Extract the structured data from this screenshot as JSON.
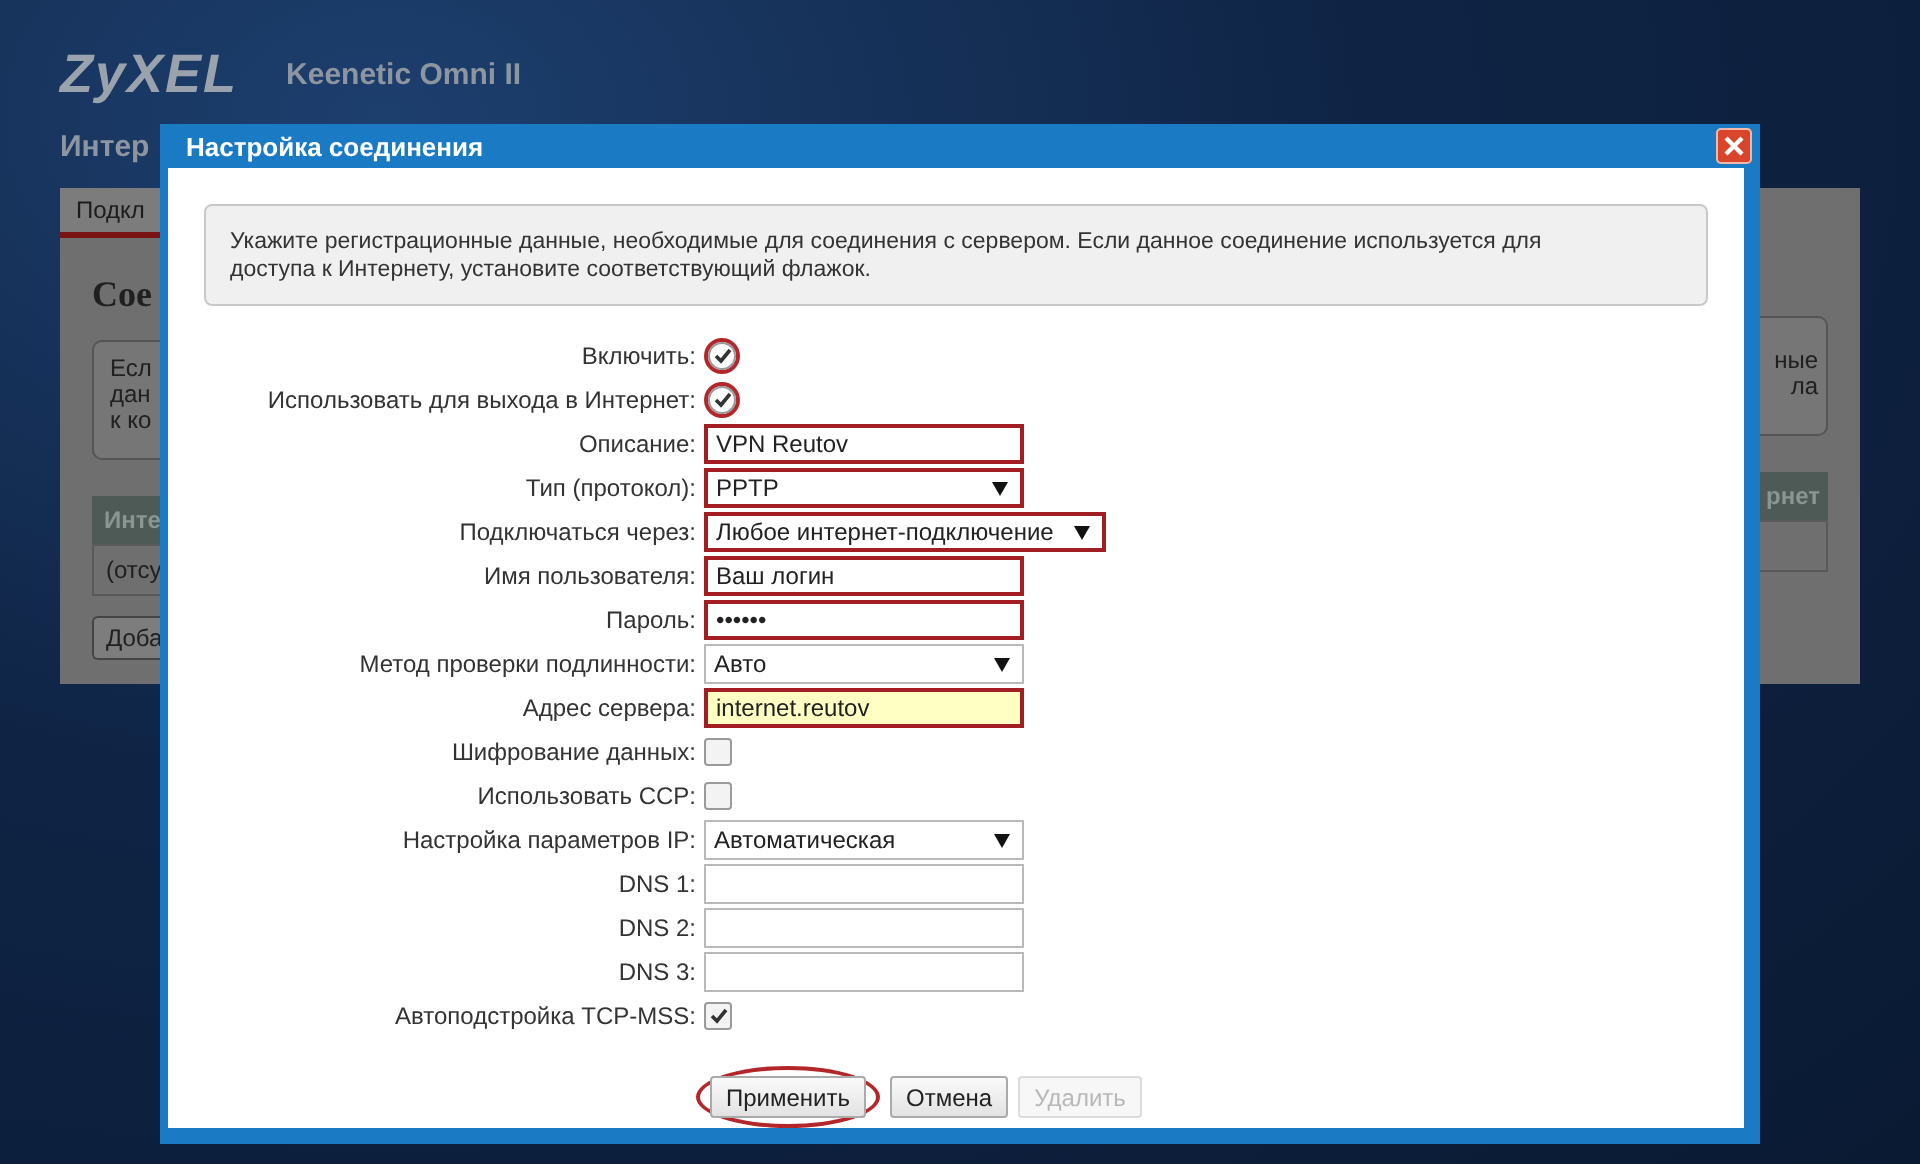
{
  "page": {
    "logo": "ZyXEL",
    "model": "Keenetic Omni II",
    "heading": "Интер",
    "tab": "Подкл",
    "section_title": "Сое",
    "info_left": [
      "Есл",
      "дан",
      "к ко"
    ],
    "info_right": [
      "ные",
      "ла"
    ],
    "table_header_left": "Инте",
    "table_header_right": "рнет",
    "table_row": "(отсу",
    "add_button": "Доба"
  },
  "dialog": {
    "title": "Настройка соединения",
    "intro": "Укажите регистрационные данные, необходимые для соединения с сервером. Если данное соединение используется для доступа к Интернету, установите соответствующий флажок.",
    "fields": [
      {
        "kind": "checkbox",
        "label": "Включить:",
        "checked": true,
        "highlighted": true
      },
      {
        "kind": "checkbox",
        "label": "Использовать для выхода в Интернет:",
        "checked": true,
        "highlighted": true
      },
      {
        "kind": "text",
        "label": "Описание:",
        "value": "VPN Reutov",
        "highlighted": true
      },
      {
        "kind": "select",
        "label": "Тип (протокол):",
        "value": "PPTP",
        "highlighted": true
      },
      {
        "kind": "select",
        "label": "Подключаться через:",
        "value": "Любое интернет-подключение",
        "highlighted": true
      },
      {
        "kind": "text",
        "label": "Имя пользователя:",
        "value": "Ваш логин",
        "highlighted": true
      },
      {
        "kind": "password",
        "label": "Пароль:",
        "value": "••••••",
        "highlighted": true
      },
      {
        "kind": "select",
        "label": "Метод проверки подлинности:",
        "value": "Авто",
        "highlighted": false
      },
      {
        "kind": "text",
        "label": "Адрес сервера:",
        "value": "internet.reutov",
        "highlighted": true,
        "autofilled": true
      },
      {
        "kind": "checkbox",
        "label": "Шифрование данных:",
        "checked": false,
        "highlighted": false
      },
      {
        "kind": "checkbox",
        "label": "Использовать CCP:",
        "checked": false,
        "highlighted": false
      },
      {
        "kind": "select",
        "label": "Настройка параметров IP:",
        "value": "Автоматическая",
        "highlighted": false
      },
      {
        "kind": "text",
        "label": "DNS 1:",
        "highlighted": false
      },
      {
        "kind": "text",
        "label": "DNS 2:",
        "highlighted": false
      },
      {
        "kind": "text",
        "label": "DNS 3:",
        "highlighted": false
      },
      {
        "kind": "checkbox",
        "label": "Автоподстройка TCP-MSS:",
        "checked": true,
        "highlighted": false
      }
    ],
    "buttons": [
      {
        "label": "Применить",
        "highlighted": true,
        "disabled": false
      },
      {
        "label": "Отмена",
        "highlighted": false,
        "disabled": false
      },
      {
        "label": "Удалить",
        "highlighted": false,
        "disabled": true
      }
    ]
  }
}
